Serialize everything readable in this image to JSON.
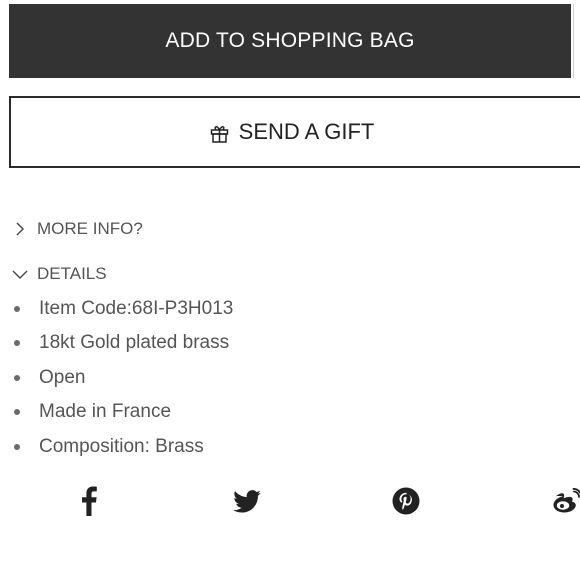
{
  "actions": {
    "add_to_bag_label": "ADD TO SHOPPING BAG",
    "send_gift_label": "SEND A GIFT"
  },
  "accordion": {
    "more_info_label": "MORE INFO?",
    "details_label": "DETAILS"
  },
  "details": {
    "items": [
      "Item Code:68I-P3H013",
      "18kt Gold plated brass",
      "Open",
      "Made in France",
      "Composition: Brass"
    ]
  },
  "social": {
    "icons": [
      "facebook-icon",
      "twitter-icon",
      "pinterest-icon",
      "weibo-icon"
    ]
  },
  "colors": {
    "button_bg": "#333333",
    "text_gray": "#555555",
    "border": "#2b2b2b"
  }
}
